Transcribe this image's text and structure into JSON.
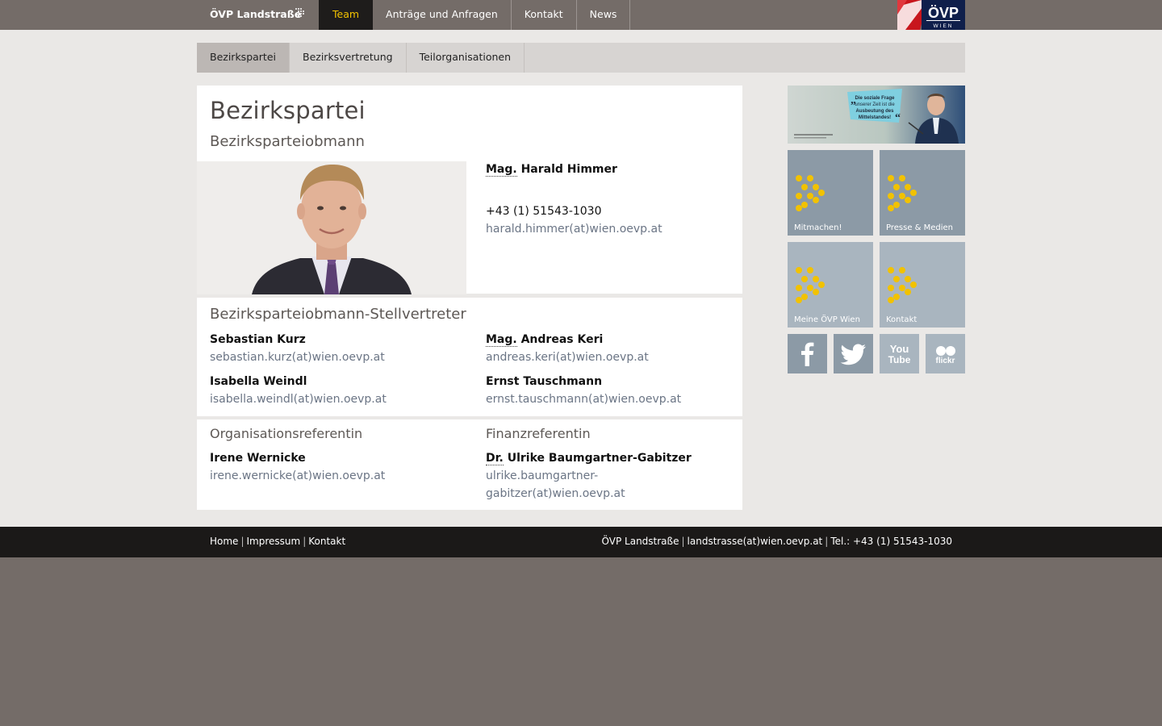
{
  "header": {
    "brand": "ÖVP Landstraße",
    "nav": [
      {
        "label": "Team",
        "active": true
      },
      {
        "label": "Anträge und Anfragen",
        "active": false
      },
      {
        "label": "Kontakt",
        "active": false
      },
      {
        "label": "News",
        "active": false
      }
    ],
    "logo_text": "ÖVP",
    "logo_sub": "WIEN"
  },
  "subnav": [
    {
      "label": "Bezirkspartei",
      "active": true
    },
    {
      "label": "Bezirksvertretung",
      "active": false
    },
    {
      "label": "Teilorganisationen",
      "active": false
    }
  ],
  "main": {
    "title": "Bezirkspartei",
    "chair": {
      "section_title": "Bezirksparteiobmann",
      "title_abbr": "Mag.",
      "name": "Harald Himmer",
      "phone": "+43 (1) 51543-1030",
      "email": "harald.himmer(at)wien.oevp.at"
    },
    "deputies": {
      "section_title": "Bezirksparteiobmann-Stellvertreter",
      "people": [
        {
          "title_abbr": "",
          "name": "Sebastian Kurz",
          "email": "sebastian.kurz(at)wien.oevp.at"
        },
        {
          "title_abbr": "Mag.",
          "name": "Andreas Keri",
          "email": "andreas.keri(at)wien.oevp.at"
        },
        {
          "title_abbr": "",
          "name": "Isabella Weindl",
          "email": "isabella.weindl(at)wien.oevp.at"
        },
        {
          "title_abbr": "",
          "name": "Ernst Tauschmann",
          "email": "ernst.tauschmann(at)wien.oevp.at"
        }
      ]
    },
    "org": {
      "section_title": "Organisationsreferentin",
      "name": "Irene Wernicke",
      "email": "irene.wernicke(at)wien.oevp.at"
    },
    "finance": {
      "section_title": "Finanzreferentin",
      "title_abbr": "Dr.",
      "name": "Ulrike Baumgartner-Gabitzer",
      "email_line1": "ulrike.baumgartner-",
      "email_line2": "gabitzer(at)wien.oevp.at"
    }
  },
  "sidebar": {
    "banner_quote_1": "Die soziale Frage",
    "banner_quote_2": "unserer Zeit ist die",
    "banner_quote_3": "Ausbeutung des",
    "banner_quote_4": "Mittelstandes!",
    "tiles": [
      {
        "label": "Mitmachen!"
      },
      {
        "label": "Presse & Medien"
      },
      {
        "label": "Meine ÖVP Wien"
      },
      {
        "label": "Kontakt"
      }
    ],
    "social": [
      {
        "icon": "facebook-icon"
      },
      {
        "icon": "twitter-icon"
      },
      {
        "icon": "youtube-icon",
        "text1": "You",
        "text2": "Tube"
      },
      {
        "icon": "flickr-icon",
        "text": "flickr"
      }
    ]
  },
  "footer": {
    "links": [
      "Home",
      "Impressum",
      "Kontakt"
    ],
    "org": "ÖVP Landstraße",
    "email": "landstrasse(at)wien.oevp.at",
    "tel": "Tel.: +43 (1) 51543-1030"
  },
  "colors": {
    "accent": "#f2c200",
    "topbar": "#746c68",
    "link": "#6b7585",
    "tile": "#8c9aa6"
  }
}
